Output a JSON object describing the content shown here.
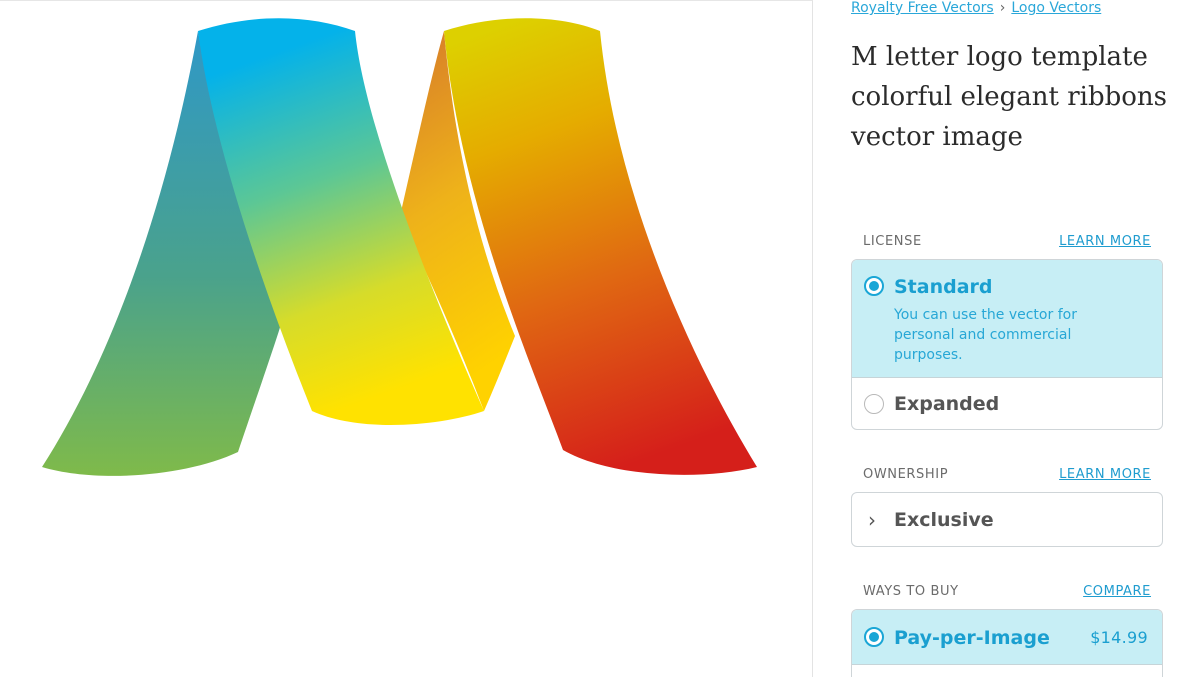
{
  "breadcrumb": {
    "items": [
      "Royalty Free Vectors",
      "Logo Vectors"
    ],
    "separator": "›"
  },
  "title": "M letter logo template colorful elegant ribbons vector image",
  "license": {
    "heading": "LICENSE",
    "link": "LEARN MORE",
    "options": [
      {
        "label": "Standard",
        "description": "You can use the vector for personal and commercial purposes.",
        "selected": true
      },
      {
        "label": "Expanded",
        "selected": false
      }
    ]
  },
  "ownership": {
    "heading": "OWNERSHIP",
    "link": "LEARN MORE",
    "option": "Exclusive",
    "chevron": "›"
  },
  "ways_to_buy": {
    "heading": "WAYS TO BUY",
    "link": "COMPARE",
    "options": [
      {
        "label": "Pay-per-Image",
        "price": "$14.99",
        "selected": true
      }
    ]
  },
  "colors": {
    "accent": "#1aa6d6",
    "selected_bg": "#c7eef5",
    "ribbon_blue": "#04b2ea",
    "ribbon_green": "#7fba4a",
    "ribbon_yellow": "#ffe200",
    "ribbon_gold": "#ddd000",
    "ribbon_red": "#d51f1a"
  },
  "icons": {
    "radio_selected": "radio-selected-icon",
    "radio_unselected": "radio-unselected-icon",
    "chevron": "chevron-right-icon"
  }
}
